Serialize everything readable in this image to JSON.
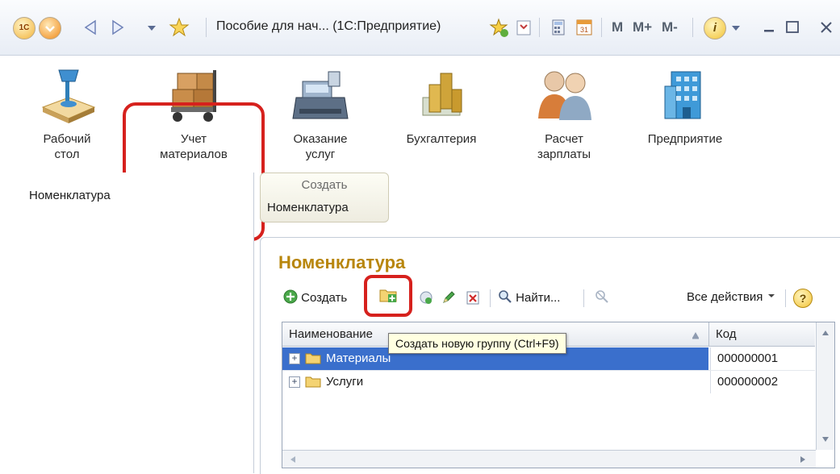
{
  "titlebar": {
    "title": "Пособие для нач... (1С:Предприятие)",
    "logo": "1С",
    "memory_buttons": [
      "M",
      "M+",
      "M-"
    ],
    "icons": [
      "app-logo-icon",
      "dropdown-circle-icon",
      "back-arrow-icon",
      "forward-arrow-icon",
      "history-dropdown-icon",
      "favorites-star-icon",
      "star-add-icon",
      "bookmark-icon",
      "calculator-icon",
      "calendar-icon",
      "info-icon",
      "minimize-icon",
      "restore-icon",
      "close-icon"
    ]
  },
  "sections": [
    {
      "label": "Рабочий стол",
      "line1": "Рабочий",
      "line2": "стол",
      "icon": "desk-lamp-icon"
    },
    {
      "label": "Учет материалов",
      "line1": "Учет",
      "line2": "материалов",
      "icon": "boxes-cart-icon"
    },
    {
      "label": "Оказание услуг",
      "line1": "Оказание",
      "line2": "услуг",
      "icon": "cash-register-icon"
    },
    {
      "label": "Бухгалтерия",
      "line1": "Бухгалтерия",
      "line2": "",
      "icon": "coins-icon"
    },
    {
      "label": "Расчет зарплаты",
      "line1": "Расчет",
      "line2": "зарплаты",
      "icon": "people-icon"
    },
    {
      "label": "Предприятие",
      "line1": "Предприятие",
      "line2": "",
      "icon": "building-icon"
    }
  ],
  "leftnav": {
    "items": [
      "Номенклатура"
    ]
  },
  "actions": {
    "header": "Создать",
    "items": [
      "Номенклатура"
    ]
  },
  "main": {
    "title": "Номенклатура",
    "toolbar": {
      "create_label": "Создать",
      "find_label": "Найти...",
      "all_actions_label": "Все действия",
      "help_label": "?"
    },
    "tooltip": "Создать новую группу (Ctrl+F9)",
    "table": {
      "columns": [
        "Наименование",
        "Код"
      ],
      "rows": [
        {
          "name": "Материалы",
          "code": "000000001",
          "selected": true
        },
        {
          "name": "Услуги",
          "code": "000000002",
          "selected": false
        }
      ]
    }
  },
  "colors": {
    "highlight": "#d6211d",
    "title_accent": "#b8860b",
    "selection": "#3a6fcc"
  }
}
